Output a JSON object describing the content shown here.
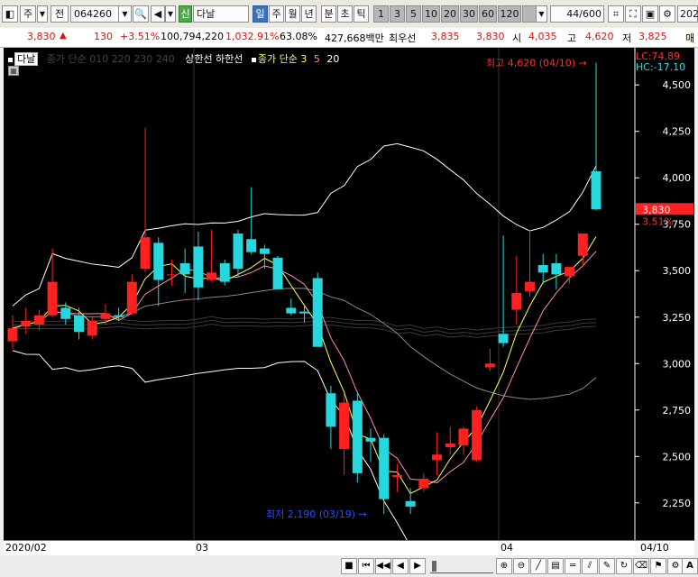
{
  "toolbar": {
    "period_week": "주",
    "period_label": "전",
    "code": "064260",
    "badge_new": "신",
    "name": "다날",
    "tabs": [
      "일",
      "주",
      "월",
      "년",
      "분",
      "초",
      "틱"
    ],
    "nums": [
      "1",
      "3",
      "5",
      "10",
      "20",
      "30",
      "60",
      "120"
    ],
    "count": "44",
    "count_total": "/600",
    "year": "202"
  },
  "quote": {
    "price": "3,830",
    "change": "130",
    "change_pct": "+3.51%",
    "volume": "100,794,220",
    "vol_pct": "1,032.91%",
    "turnover": "63.08%",
    "amount": "427,668백만",
    "best_ask_label": "최우선",
    "best_ask": "3,835",
    "best_bid": "3,830",
    "open_label": "시",
    "open": "4,035",
    "high_label": "고",
    "high": "4,620",
    "low_label": "저",
    "low": "3,825",
    "extra": "매"
  },
  "legend": {
    "name": "다날",
    "ma_dim": "종가 단순 010 220 230 240",
    "band": "상한선  하한선",
    "ma_label": "종가 단순 3",
    "ma5": "5",
    "ma20": "20"
  },
  "annotations": {
    "high": "최고 4,620 (04/10)",
    "low": "최저 2,190 (03/19)",
    "lc": "LC:74.89",
    "hc": "HC:-17.10",
    "price_tag": "3,830",
    "pct_tag": "3.51%"
  },
  "colors": {
    "up": "#ff2020",
    "down": "#26d7dd",
    "ma3": "#ffff55",
    "ma5": "#ff8bb0",
    "band": "#ffffff",
    "bg": "#000000"
  },
  "chart_data": {
    "type": "candlestick",
    "y_ticks": [
      2250,
      2500,
      2750,
      3000,
      3250,
      3500,
      3750,
      4000,
      4250,
      4500
    ],
    "y_range": [
      2050,
      4700
    ],
    "x_labels": [
      "2020/02",
      "03",
      "04",
      "04/10"
    ],
    "candles": [
      {
        "o": 3120,
        "h": 3260,
        "l": 3080,
        "c": 3190
      },
      {
        "o": 3200,
        "h": 3300,
        "l": 3160,
        "c": 3230
      },
      {
        "o": 3210,
        "h": 3290,
        "l": 3180,
        "c": 3260
      },
      {
        "o": 3260,
        "h": 3620,
        "l": 3250,
        "c": 3440
      },
      {
        "o": 3300,
        "h": 3330,
        "l": 3210,
        "c": 3240
      },
      {
        "o": 3260,
        "h": 3300,
        "l": 3130,
        "c": 3170
      },
      {
        "o": 3150,
        "h": 3250,
        "l": 3130,
        "c": 3230
      },
      {
        "o": 3240,
        "h": 3320,
        "l": 3210,
        "c": 3270
      },
      {
        "o": 3260,
        "h": 3300,
        "l": 3230,
        "c": 3250
      },
      {
        "o": 3270,
        "h": 3480,
        "l": 3260,
        "c": 3440
      },
      {
        "o": 3510,
        "h": 4270,
        "l": 3490,
        "c": 3680
      },
      {
        "o": 3650,
        "h": 3680,
        "l": 3310,
        "c": 3450
      },
      {
        "o": 3480,
        "h": 3560,
        "l": 3420,
        "c": 3480
      },
      {
        "o": 3540,
        "h": 3620,
        "l": 3380,
        "c": 3480
      },
      {
        "o": 3630,
        "h": 3710,
        "l": 3340,
        "c": 3410
      },
      {
        "o": 3450,
        "h": 3720,
        "l": 3440,
        "c": 3490
      },
      {
        "o": 3540,
        "h": 3560,
        "l": 3420,
        "c": 3440
      },
      {
        "o": 3700,
        "h": 3720,
        "l": 3470,
        "c": 3510
      },
      {
        "o": 3670,
        "h": 3950,
        "l": 3590,
        "c": 3600
      },
      {
        "o": 3620,
        "h": 3640,
        "l": 3510,
        "c": 3590
      },
      {
        "o": 3570,
        "h": 3580,
        "l": 3400,
        "c": 3400
      },
      {
        "o": 3300,
        "h": 3350,
        "l": 3260,
        "c": 3270
      },
      {
        "o": 3280,
        "h": 3310,
        "l": 3220,
        "c": 3270
      },
      {
        "o": 3460,
        "h": 3490,
        "l": 3090,
        "c": 3090
      },
      {
        "o": 2840,
        "h": 2880,
        "l": 2540,
        "c": 2660
      },
      {
        "o": 2540,
        "h": 2840,
        "l": 2400,
        "c": 2790
      },
      {
        "o": 2800,
        "h": 2840,
        "l": 2360,
        "c": 2410
      },
      {
        "o": 2600,
        "h": 2650,
        "l": 2470,
        "c": 2580
      },
      {
        "o": 2600,
        "h": 2620,
        "l": 2190,
        "c": 2270
      },
      {
        "o": 2390,
        "h": 2460,
        "l": 2310,
        "c": 2400
      },
      {
        "o": 2260,
        "h": 2330,
        "l": 2190,
        "c": 2230
      },
      {
        "o": 2330,
        "h": 2410,
        "l": 2310,
        "c": 2380
      },
      {
        "o": 2480,
        "h": 2630,
        "l": 2400,
        "c": 2510
      },
      {
        "o": 2550,
        "h": 2660,
        "l": 2510,
        "c": 2570
      },
      {
        "o": 2560,
        "h": 2660,
        "l": 2510,
        "c": 2650
      },
      {
        "o": 2480,
        "h": 2770,
        "l": 2470,
        "c": 2750
      },
      {
        "o": 2980,
        "h": 3080,
        "l": 2960,
        "c": 3000
      },
      {
        "o": 3160,
        "h": 3690,
        "l": 3090,
        "c": 3110
      },
      {
        "o": 3290,
        "h": 3580,
        "l": 3210,
        "c": 3380
      },
      {
        "o": 3390,
        "h": 3720,
        "l": 3360,
        "c": 3440
      },
      {
        "o": 3530,
        "h": 3590,
        "l": 3430,
        "c": 3490
      },
      {
        "o": 3540,
        "h": 3590,
        "l": 3400,
        "c": 3480
      },
      {
        "o": 3470,
        "h": 3510,
        "l": 3430,
        "c": 3520
      },
      {
        "o": 3580,
        "h": 3700,
        "l": 3520,
        "c": 3700
      },
      {
        "o": 4035,
        "h": 4620,
        "l": 3825,
        "c": 3830
      }
    ]
  }
}
